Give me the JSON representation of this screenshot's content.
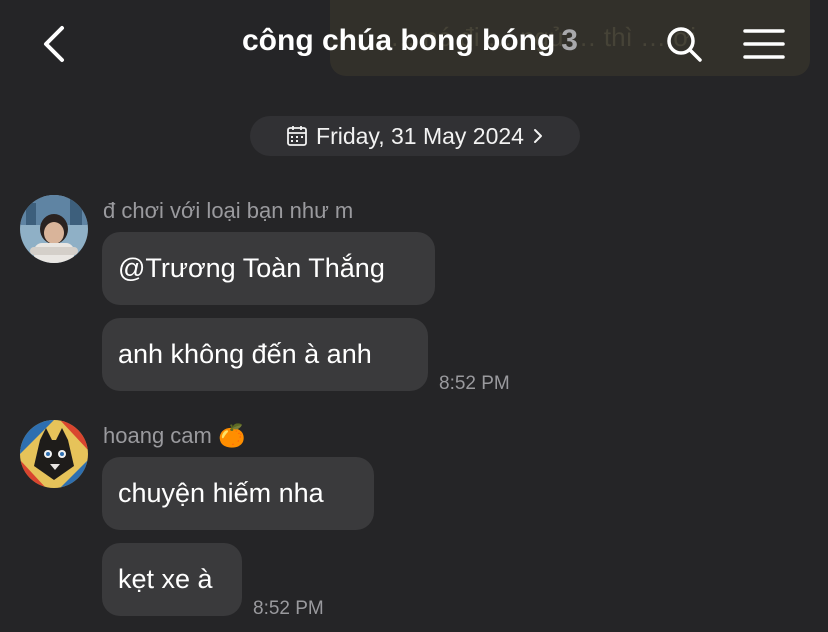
{
  "header": {
    "title": "công chúa bong bóng",
    "member_count": "3",
    "overlay_text": "… nó đi … ngủ … thì … ơi"
  },
  "date_divider": {
    "label": "Friday, 31 May 2024"
  },
  "groups": [
    {
      "sender": "đ chơi với loại bạn như m",
      "messages": [
        "@Trương Toàn Thắng",
        "anh không đến à anh"
      ],
      "time": "8:52 PM"
    },
    {
      "sender": "hoang cam 🍊",
      "messages": [
        "chuyện hiếm nha",
        "kẹt xe à"
      ],
      "time": "8:52 PM"
    }
  ],
  "icons": {
    "back": "chevron-left-icon",
    "search": "search-icon",
    "menu": "hamburger-menu-icon",
    "calendar": "calendar-icon",
    "chevron": "chevron-right-icon"
  },
  "colors": {
    "background": "#252527",
    "bubble": "#3a3a3c",
    "secondary_text": "#9a9a9e"
  }
}
